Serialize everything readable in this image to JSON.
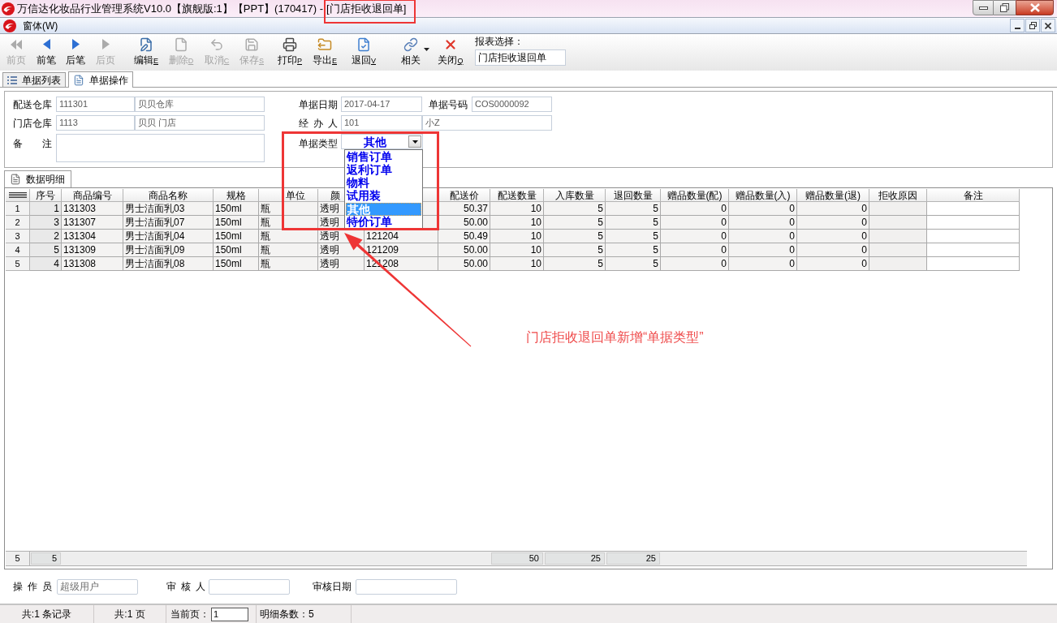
{
  "window": {
    "title": "万信达化妆品行业管理系统V10.0【旗舰版:1】【PPT】(170417) -",
    "document": "[门店拒收退回单]"
  },
  "menu": [
    "窗体(W)"
  ],
  "toolbar": {
    "buttons": [
      {
        "label": "前页",
        "disabled": true
      },
      {
        "label": "前笔",
        "disabled": false
      },
      {
        "label": "后笔",
        "disabled": false
      },
      {
        "label": "后页",
        "disabled": true
      },
      {
        "label": "编辑",
        "hotkey": "E",
        "disabled": false
      },
      {
        "label": "删除",
        "hotkey": "D",
        "disabled": true
      },
      {
        "label": "取消",
        "hotkey": "C",
        "disabled": true
      },
      {
        "label": "保存",
        "hotkey": "S",
        "disabled": true
      },
      {
        "label": "打印",
        "hotkey": "P",
        "disabled": false
      },
      {
        "label": "导出",
        "hotkey": "E",
        "disabled": false
      },
      {
        "label": "退回",
        "hotkey": "V",
        "disabled": false
      },
      {
        "label": "相关",
        "disabled": false,
        "has_menu": true
      },
      {
        "label": "关闭",
        "hotkey": "Q",
        "disabled": false
      }
    ],
    "report_select": {
      "label": "报表选择：",
      "value": "门店拒收退回单"
    }
  },
  "tabs": [
    {
      "label": "单据列表",
      "selected": false
    },
    {
      "label": "单据操作",
      "selected": true
    }
  ],
  "header": {
    "delivery_warehouse": {
      "label": "配送仓库",
      "code": "111301",
      "name": "贝贝仓库"
    },
    "store_warehouse": {
      "label": "门店仓库",
      "code": "1113",
      "name": "贝贝 门店"
    },
    "remark": {
      "label": "备 注"
    },
    "doc_date": {
      "label": "单据日期",
      "value": "2017-04-17"
    },
    "doc_number": {
      "label": "单据号码",
      "value": "COS0000092"
    },
    "handler": {
      "label": "经 办 人",
      "code": "101",
      "name": "小Z"
    },
    "doc_type": {
      "label": "单据类型",
      "value": "其他",
      "expanded": true,
      "options": [
        {
          "label": "销售订单",
          "selected": false
        },
        {
          "label": "返利订单",
          "selected": false
        },
        {
          "label": "物料",
          "selected": false
        },
        {
          "label": "试用装",
          "selected": false
        },
        {
          "label": "其他",
          "selected": true
        },
        {
          "label": "特价订单",
          "selected": false
        }
      ]
    }
  },
  "detail_tab": {
    "label": "数据明细",
    "selected": true
  },
  "table": {
    "columns": [
      "序号",
      "商品编号",
      "商品名称",
      "规格",
      "单位",
      "颜",
      null,
      "配送价",
      "配送数量",
      "入库数量",
      "退回数量",
      "赠品数量(配)",
      "赠品数量(入)",
      "赠品数量(退)",
      "拒收原因",
      "备注"
    ],
    "rows": [
      {
        "row_number": "1",
        "cells": [
          "1",
          "131303",
          "男士洁面乳03",
          "150ml",
          "瓶",
          "透明",
          null,
          "50.37",
          "10",
          "5",
          "5",
          "0",
          "0",
          "0"
        ]
      },
      {
        "row_number": "2",
        "cells": [
          "3",
          "131307",
          "男士洁面乳07",
          "150ml",
          "瓶",
          "透明",
          null,
          "50.00",
          "10",
          "5",
          "5",
          "0",
          "0",
          "0"
        ]
      },
      {
        "row_number": "3",
        "cells": [
          "2",
          "131304",
          "男士洁面乳04",
          "150ml",
          "瓶",
          "透明",
          "121204",
          "50.49",
          "10",
          "5",
          "5",
          "0",
          "0",
          "0"
        ]
      },
      {
        "row_number": "4",
        "cells": [
          "5",
          "131309",
          "男士洁面乳09",
          "150ml",
          "瓶",
          "透明",
          "121209",
          "50.00",
          "10",
          "5",
          "5",
          "0",
          "0",
          "0"
        ]
      },
      {
        "row_number": "5",
        "cells": [
          "4",
          "131308",
          "男士洁面乳08",
          "150ml",
          "瓶",
          "透明",
          "121208",
          "50.00",
          "10",
          "5",
          "5",
          "0",
          "0",
          "0"
        ]
      }
    ],
    "totals": {
      "row_count": "5",
      "cells": [
        "5",
        null,
        null,
        null,
        null,
        null,
        null,
        null,
        "50",
        "25",
        "25"
      ]
    }
  },
  "footer_fields": [
    {
      "label": "操 作 员",
      "value": "超级用户"
    },
    {
      "label": "审 核 人"
    },
    {
      "label": "审核日期"
    }
  ],
  "status_bar": {
    "records": "共:1 条记录",
    "pages": "共:1 页",
    "current_page_label": "当前页：",
    "current_page": "1",
    "detail_count": "明细条数：5"
  },
  "annotation": {
    "note": "门店拒收退回单新增“单据类型”"
  }
}
